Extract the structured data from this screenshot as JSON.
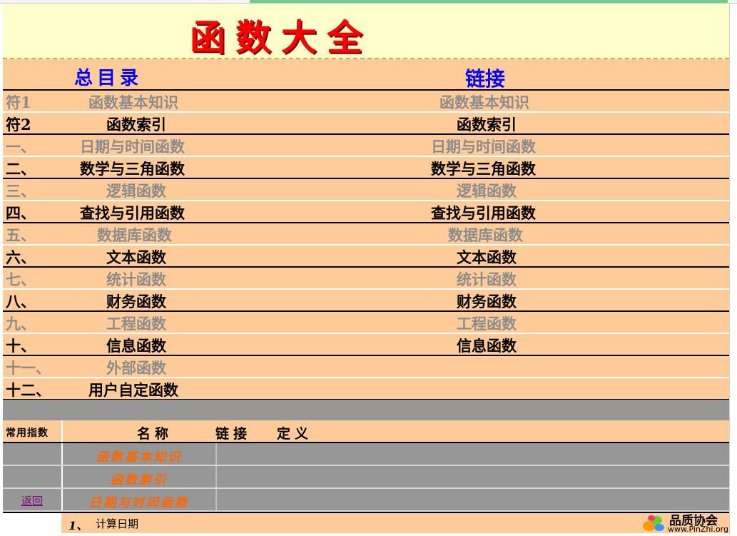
{
  "title": "函数大全",
  "header": {
    "left": "总目录",
    "right": "链接"
  },
  "rows": [
    {
      "num": "符1",
      "name": "函数基本知识",
      "link": "函数基本知识",
      "grey": true
    },
    {
      "num": "符2",
      "name": "函数索引",
      "link": "函数索引",
      "grey": false
    },
    {
      "num": "一、",
      "name": "日期与时间函数",
      "link": "日期与时间函数",
      "grey": true
    },
    {
      "num": "二、",
      "name": "数学与三角函数",
      "link": "数学与三角函数",
      "grey": false
    },
    {
      "num": "三、",
      "name": "逻辑函数",
      "link": "逻辑函数",
      "grey": true
    },
    {
      "num": "四、",
      "name": "查找与引用函数",
      "link": "查找与引用函数",
      "grey": false
    },
    {
      "num": "五、",
      "name": "数据库函数",
      "link": "数据库函数",
      "grey": true
    },
    {
      "num": "六、",
      "name": "文本函数",
      "link": "文本函数",
      "grey": false
    },
    {
      "num": "七、",
      "name": "统计函数",
      "link": "统计函数",
      "grey": true
    },
    {
      "num": "八、",
      "name": "财务函数",
      "link": "财务函数",
      "grey": false
    },
    {
      "num": "九、",
      "name": "工程函数",
      "link": "工程函数",
      "grey": true
    },
    {
      "num": "十、",
      "name": "信息函数",
      "link": "信息函数",
      "grey": false
    },
    {
      "num": "十一、",
      "name": "外部函数",
      "link": "",
      "grey": true
    },
    {
      "num": "十二、",
      "name": "用户自定函数",
      "link": "",
      "grey": false
    }
  ],
  "sub_header": {
    "label": "常用指数",
    "col_name": "名称",
    "col_link": "链接",
    "col_def": "定义"
  },
  "sub_rows": [
    {
      "name": "函数基本知识",
      "back": ""
    },
    {
      "name": "函数索引",
      "back": ""
    },
    {
      "name": "日期与时间函数",
      "back": "返回"
    }
  ],
  "bottom": {
    "num": "1、",
    "text": "计算日期"
  },
  "logo": {
    "brand": "品质协会",
    "url": "www.PinZhi.org"
  },
  "colors": {
    "title": "#ff0000",
    "header_text": "#0000ff",
    "row_bg": "#ffcc99",
    "band": "#969696",
    "sub_text": "#ff6600"
  }
}
